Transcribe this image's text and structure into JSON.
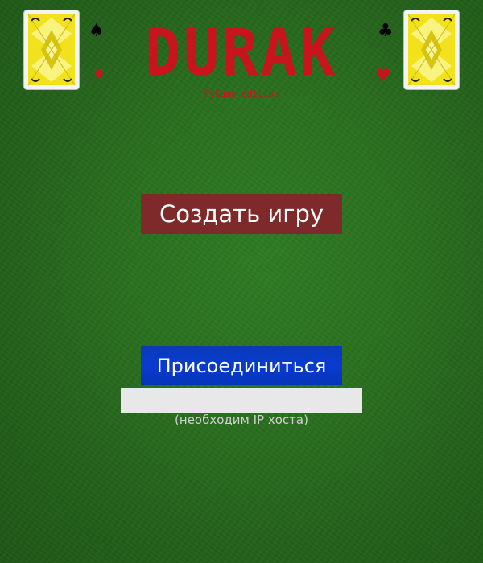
{
  "header": {
    "title": "DURAK",
    "subtitle": "PyGame edition",
    "suits": {
      "spade": "♠",
      "diamond": "♦",
      "club": "♣",
      "heart": "♥"
    },
    "card_back_icon": "card-back-icon"
  },
  "menu": {
    "create_game_label": "Создать игру",
    "join_label": "Присоединиться",
    "ip_input_value": "",
    "ip_hint": "(необходим IP хоста)"
  },
  "colors": {
    "felt": "#2a701f",
    "title_red": "#c8141c",
    "create_button": "#7e2a2a",
    "join_button": "#083bd0",
    "input_bg": "#e8e8e8",
    "hint_text": "#d0d0d0"
  }
}
